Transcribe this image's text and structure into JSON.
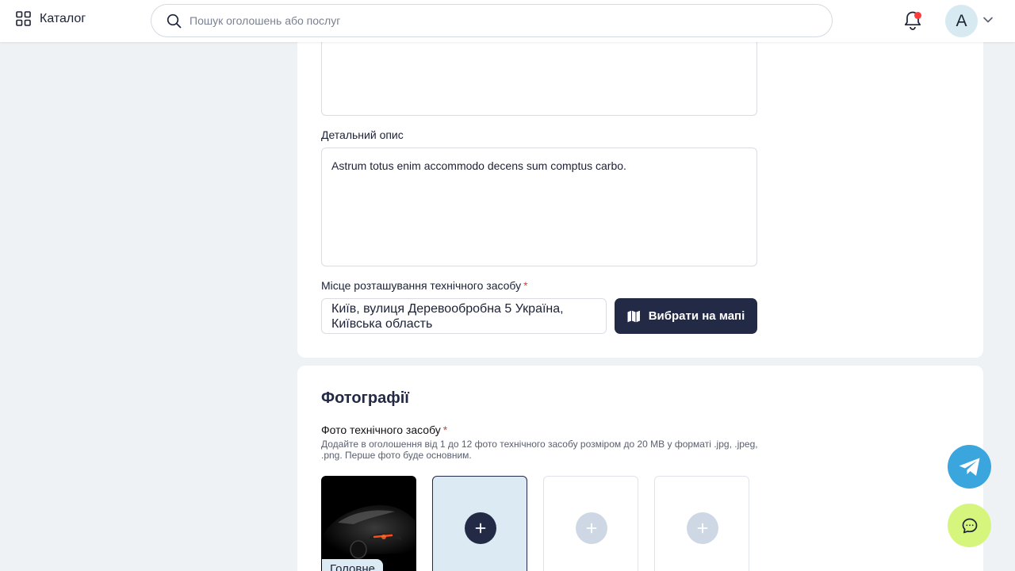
{
  "header": {
    "catalog_label": "Каталог",
    "search_placeholder": "Пошук оголошень або послуг",
    "avatar_initial": "A",
    "notification_dot_color": "#ff3b3b"
  },
  "form": {
    "detail_label": "Детальний опис",
    "detail_value": "Astrum totus enim accommodo decens sum comptus carbo.",
    "location_label": "Місце розташування технічного засобу",
    "required_mark": "*",
    "location_value": "Київ, вулиця Деревообробна 5 Україна, Київська область",
    "map_button_label": "Вибрати на мапі"
  },
  "photos": {
    "section_title": "Фотографії",
    "field_label": "Фото технічного засобу",
    "required_mark": "*",
    "hint": "Додайте в оголошення від 1 до 12 фото технічного засобу розміром до 20 MB у форматі .jpg, .jpeg, .png. Перше фото буде основним.",
    "main_badge": "Головне"
  },
  "colors": {
    "brand_dark": "#232a45",
    "telegram": "#3ba5dd",
    "chat": "#d6f57d",
    "required": "#e23b3b"
  },
  "icons": [
    "grid-icon",
    "search-icon",
    "bell-icon",
    "chevron-down-icon",
    "map-icon",
    "plus-icon",
    "telegram-icon",
    "chat-icon"
  ]
}
